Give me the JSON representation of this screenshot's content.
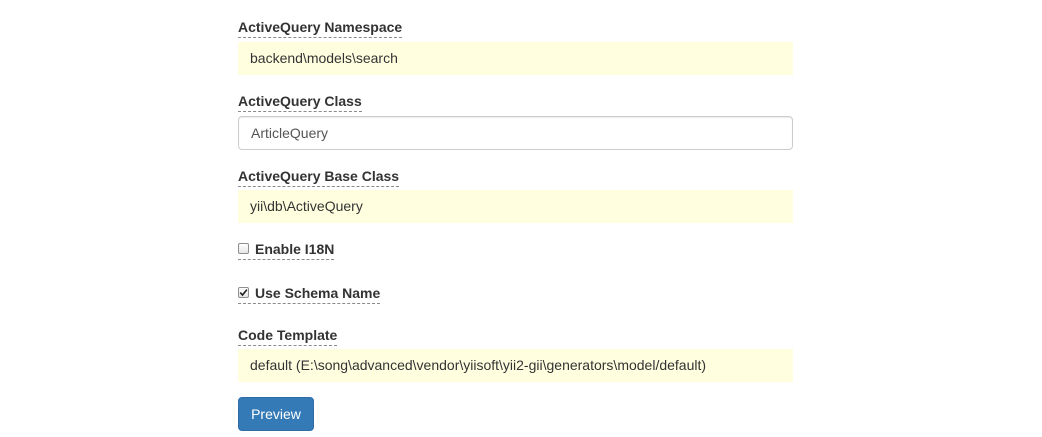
{
  "form": {
    "query_ns": {
      "label": "ActiveQuery Namespace",
      "value": "backend\\models\\search"
    },
    "query_class": {
      "label": "ActiveQuery Class",
      "value": "ArticleQuery"
    },
    "query_base_class": {
      "label": "ActiveQuery Base Class",
      "value": "yii\\db\\ActiveQuery"
    },
    "enable_i18n": {
      "label": "Enable I18N",
      "checked": false
    },
    "use_schema_name": {
      "label": "Use Schema Name",
      "checked": true
    },
    "code_template": {
      "label": "Code Template",
      "value": "default (E:\\song\\advanced\\vendor\\yiisoft\\yii2-gii\\generators\\model/default)"
    },
    "preview_button": {
      "label": "Preview"
    }
  },
  "colors": {
    "sticky_background": "#ffffe0",
    "primary_button": "#337ab7",
    "label_text": "#333333"
  }
}
